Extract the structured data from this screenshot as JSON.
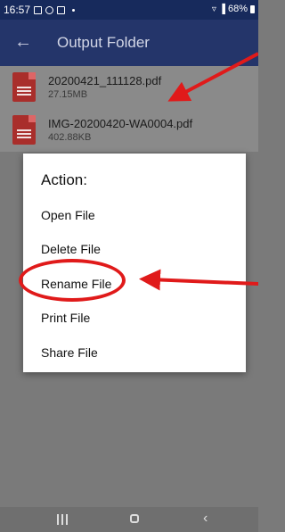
{
  "status_bar": {
    "time": "16:57",
    "battery": "68%"
  },
  "app_bar": {
    "back_icon": "arrow-left-icon",
    "title": "Output Folder"
  },
  "files": [
    {
      "name": "20200421_111128.pdf",
      "size": "27.15MB",
      "icon": "pdf-icon"
    },
    {
      "name": "IMG-20200420-WA0004.pdf",
      "size": "402.88KB",
      "icon": "pdf-icon"
    }
  ],
  "dialog": {
    "title": "Action:",
    "items": [
      "Open File",
      "Delete File",
      "Rename File",
      "Print File",
      "Share File"
    ]
  },
  "annotation_color": "#e01a1a",
  "nav": {
    "recents": "recents-icon",
    "home": "home-icon",
    "back": "back-icon"
  }
}
